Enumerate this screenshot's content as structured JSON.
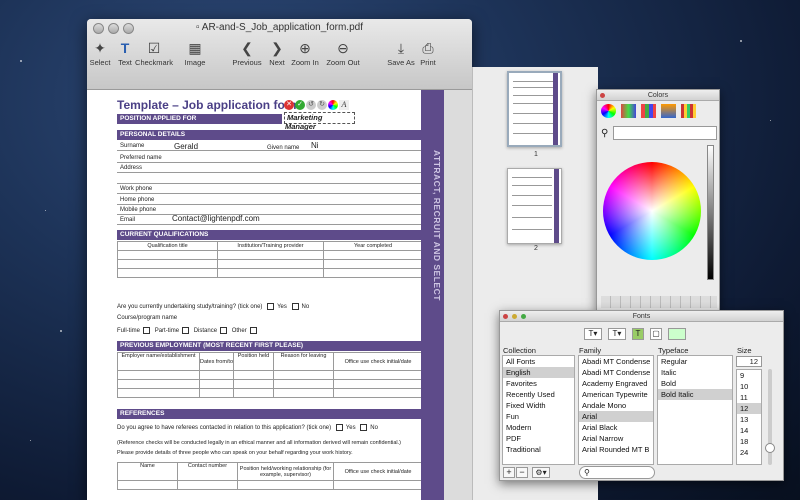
{
  "window": {
    "title": "AR-and-S_Job_application_form.pdf"
  },
  "toolbar": {
    "select": "Select",
    "text": "Text",
    "checkmark": "Checkmark",
    "image": "Image",
    "previous": "Previous",
    "next": "Next",
    "zoom_in": "Zoom In",
    "zoom_out": "Zoom Out",
    "save_as": "Save As",
    "print": "Print"
  },
  "form": {
    "title": "Template – Job application form",
    "position_label": "POSITION APPLIED FOR",
    "position_value": "Marketing Manager",
    "personal": "PERSONAL DETAILS",
    "surname": "Surname",
    "surname_value": "Gerald",
    "given": "Given name",
    "given_value": "Ni",
    "preferred": "Preferred name",
    "address": "Address",
    "work": "Work phone",
    "home": "Home phone",
    "mobile": "Mobile phone",
    "email": "Email",
    "email_value": "Contact@lightenpdf.com",
    "current": "CURRENT QUALIFICATIONS",
    "qual_title": "Qualification title",
    "institution": "Institution/Training provider",
    "year": "Year completed",
    "study_q": "Are you currently undertaking study/training? (tick one)",
    "yes": "Yes",
    "no": "No",
    "course": "Course/program name",
    "fulltime": "Full-time",
    "parttime": "Part-time",
    "distance": "Distance",
    "other": "Other",
    "previous": "PREVIOUS EMPLOYMENT (MOST RECENT FIRST PLEASE)",
    "employer": "Employer name/establishment",
    "dates": "Dates from/to",
    "held": "Position held",
    "reason": "Reason for leaving",
    "office": "Office use check initial/date",
    "references": "REFERENCES",
    "ref_q": "Do you agree to have referees contacted in relation to this application? (tick one)",
    "ref_note": "(Reference checks will be conducted legally in an ethical manner and all information derived will remain confidential.)",
    "ref_details": "Please provide details of three people who can speak on your behalf regarding your work history.",
    "name": "Name",
    "contact": "Contact number",
    "relationship": "Position held/working relationship (for example, supervisor)",
    "side": "ATTRACT, RECRUIT AND SELECT"
  },
  "thumbs": {
    "p1": "1",
    "p2": "2"
  },
  "colors": {
    "title": "Colors"
  },
  "fonts": {
    "title": "Fonts",
    "collection_h": "Collection",
    "family_h": "Family",
    "typeface_h": "Typeface",
    "size_h": "Size",
    "size_value": "12",
    "collections": [
      "All Fonts",
      "English",
      "Favorites",
      "Recently Used",
      "Fixed Width",
      "Fun",
      "Modern",
      "PDF",
      "Traditional"
    ],
    "families": [
      "Abadi MT Condense",
      "Abadi MT Condense",
      "Academy Engraved",
      "American Typewrite",
      "Andale Mono",
      "Arial",
      "Arial Black",
      "Arial Narrow",
      "Arial Rounded MT B"
    ],
    "typefaces": [
      "Regular",
      "Italic",
      "Bold",
      "Bold Italic"
    ],
    "sizes": [
      "9",
      "10",
      "11",
      "12",
      "13",
      "14",
      "18",
      "24"
    ]
  },
  "colors_theme": {
    "accent": "#5e4b8a"
  }
}
